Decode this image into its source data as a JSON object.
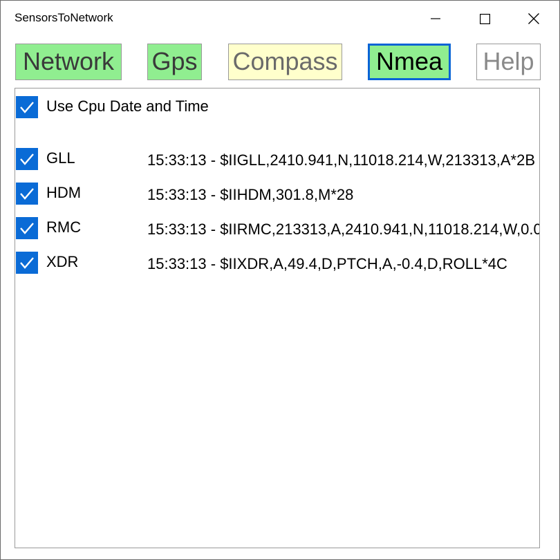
{
  "window": {
    "title": "SensorsToNetwork",
    "controls": {
      "minimize": "minimize-icon",
      "maximize": "maximize-icon",
      "close": "close-icon"
    }
  },
  "tabs": [
    {
      "label": "Network",
      "color": "#90ee90",
      "active": false
    },
    {
      "label": "Gps",
      "color": "#90ee90",
      "active": false
    },
    {
      "label": "Compass",
      "color": "#ffffcc",
      "active": false
    },
    {
      "label": "Nmea",
      "color": "#90ee90",
      "active": true
    },
    {
      "label": "Help",
      "color": "#ffffff",
      "active": false
    }
  ],
  "options": {
    "use_cpu_time": {
      "label": "Use Cpu Date and Time",
      "checked": true
    }
  },
  "sentences": [
    {
      "name": "GLL",
      "checked": true,
      "text": "15:33:13 - $IIGLL,2410.941,N,11018.214,W,213313,A*2B"
    },
    {
      "name": "HDM",
      "checked": true,
      "text": "15:33:13 - $IIHDM,301.8,M*28"
    },
    {
      "name": "RMC",
      "checked": true,
      "text": "15:33:13 - $IIRMC,213313,A,2410.941,N,11018.214,W,0.0"
    },
    {
      "name": "XDR",
      "checked": true,
      "text": "15:33:13 - $IIXDR,A,49.4,D,PTCH,A,-0.4,D,ROLL*4C"
    }
  ],
  "colors": {
    "accent": "#0a6bd6",
    "green": "#90ee90",
    "yellow": "#ffffcc"
  }
}
